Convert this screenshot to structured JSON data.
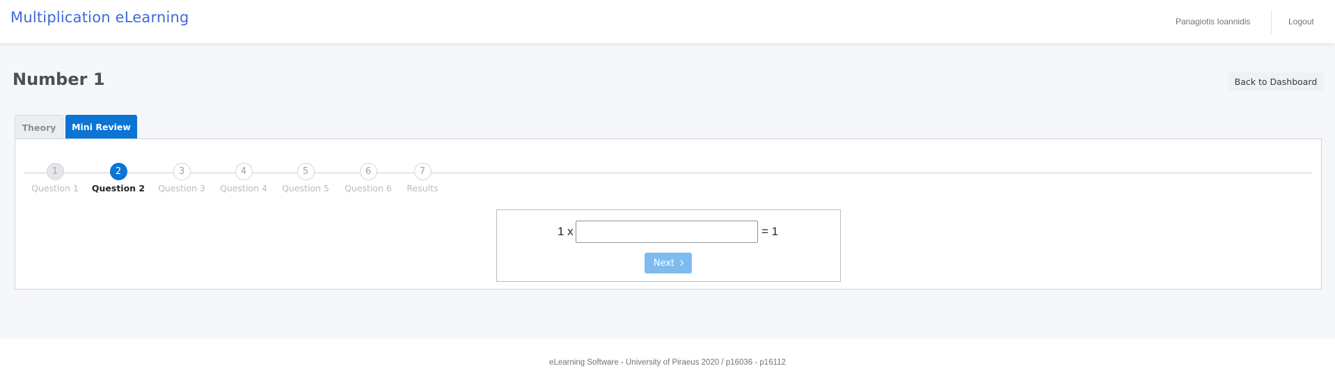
{
  "header": {
    "brand": "Multiplication eLearning",
    "user_name": "Panagiotis Ioannidis",
    "logout_label": "Logout"
  },
  "page": {
    "title": "Number 1",
    "back_button_label": "Back to Dashboard"
  },
  "tabs": [
    {
      "label": "Theory",
      "active": false
    },
    {
      "label": "Mini Review",
      "active": true
    }
  ],
  "steps": [
    {
      "number": "1",
      "label": "Question 1",
      "state": "done"
    },
    {
      "number": "2",
      "label": "Question 2",
      "state": "active"
    },
    {
      "number": "3",
      "label": "Question 3",
      "state": "pending"
    },
    {
      "number": "4",
      "label": "Question 4",
      "state": "pending"
    },
    {
      "number": "5",
      "label": "Question 5",
      "state": "pending"
    },
    {
      "number": "6",
      "label": "Question 6",
      "state": "pending"
    },
    {
      "number": "7",
      "label": "Results",
      "state": "pending"
    }
  ],
  "question": {
    "left_operand_text": "1 x",
    "answer_value": "",
    "result_text": "= 1",
    "next_label": "Next"
  },
  "footer": {
    "text": "eLearning Software - University of Piraeus 2020 / p16036 - p16112"
  },
  "colors": {
    "brand": "#3f6ad8",
    "primary": "#0b74d5",
    "next_button": "#7ebcef"
  },
  "icons": {
    "next": "chevron-right-icon"
  }
}
